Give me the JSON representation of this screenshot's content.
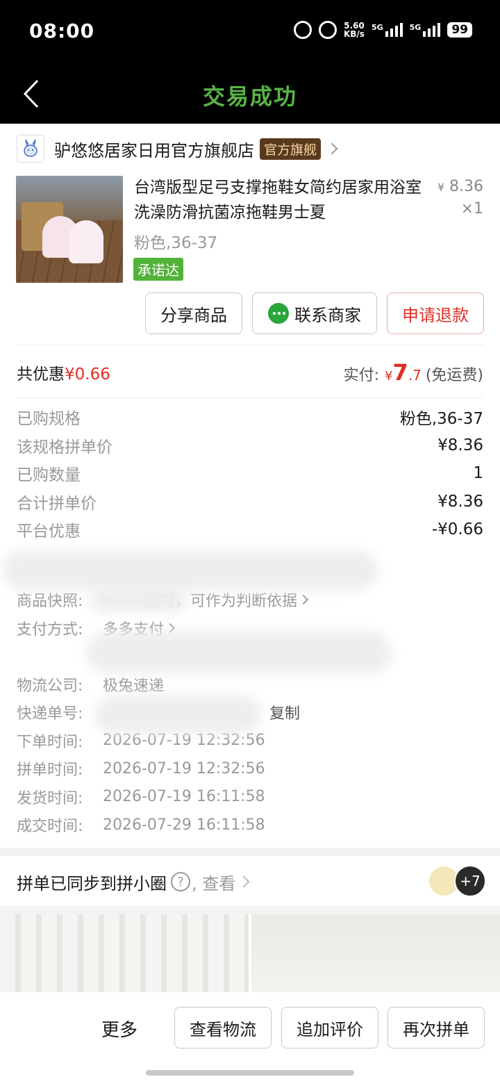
{
  "status_bar": {
    "time": "08:00",
    "speed_top": "5.60",
    "speed_unit": "KB/s",
    "net1": "5G",
    "net2": "5G",
    "battery": "99"
  },
  "header": {
    "title": "交易成功",
    "title_color": "#58b446"
  },
  "store": {
    "name": "驴悠悠居家日用官方旗舰店",
    "badge": "官方旗舰"
  },
  "product": {
    "title": "台湾版型足弓支撑拖鞋女简约居家用浴室洗澡防滑抗菌凉拖鞋男士夏",
    "currency": "¥",
    "price": "8.36",
    "quantity": "×1",
    "spec": "粉色,36-37",
    "promise_tag": "承诺达",
    "actions": {
      "share": "分享商品",
      "contact": "联系商家",
      "refund": "申请退款"
    }
  },
  "summary": {
    "discount_label": "共优惠",
    "discount_value": "¥0.66",
    "paid_label": "实付:",
    "paid_currency": "¥",
    "paid_int": "7",
    "paid_dec": ".7",
    "shipping": "(免运费)"
  },
  "specs": [
    {
      "k": "已购规格",
      "v": "粉色,36-37"
    },
    {
      "k": "该规格拼单价",
      "v": "¥8.36"
    },
    {
      "k": "已购数量",
      "v": "1"
    },
    {
      "k": "合计拼单价",
      "v": "¥8.36"
    },
    {
      "k": "平台优惠",
      "v": "-¥0.66"
    }
  ],
  "info": {
    "snapshot_k": "商品快照:",
    "snapshot_v": "议时，可作为判断依据",
    "pay_k": "支付方式:",
    "pay_v": "多多支付",
    "logistics_k": "物流公司:",
    "logistics_v": "极兔速递",
    "tracking_k": "快递单号:",
    "tracking_copy": "复制",
    "order_time_k": "下单时间:",
    "order_time_v": "2026-07-19 12:32:56",
    "group_time_k": "拼单时间:",
    "group_time_v": "2026-07-19 12:32:56",
    "ship_time_k": "发货时间:",
    "ship_time_v": "2026-07-19 16:11:58",
    "deal_time_k": "成交时间:",
    "deal_time_v": "2026-07-29 16:11:58"
  },
  "circle": {
    "text": "拼单已同步到拼小圈",
    "help": "?",
    "view": ", 查看",
    "more_count": "+7"
  },
  "bottom": {
    "more": "更多",
    "logistics": "查看物流",
    "review": "追加评价",
    "rebuy": "再次拼单"
  }
}
